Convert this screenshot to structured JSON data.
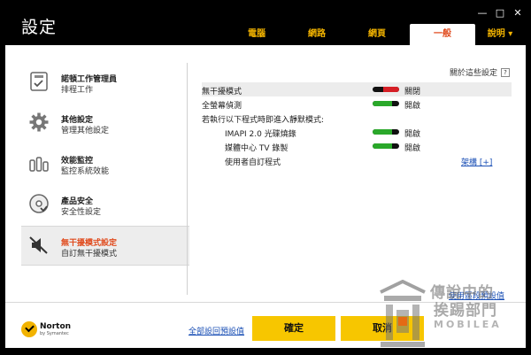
{
  "window": {
    "title": "設定",
    "controls": [
      "—",
      "□",
      "✕"
    ]
  },
  "tabs": [
    {
      "label": "電腦",
      "active": false
    },
    {
      "label": "網路",
      "active": false
    },
    {
      "label": "網頁",
      "active": false
    },
    {
      "label": "一般",
      "active": true
    },
    {
      "label": "說明 ▾",
      "active": false
    }
  ],
  "sidebar": {
    "items": [
      {
        "title": "諾頓工作管理員",
        "subtitle": "排程工作",
        "icon": "task-manager-icon"
      },
      {
        "title": "其他設定",
        "subtitle": "管理其他設定",
        "icon": "gear-icon"
      },
      {
        "title": "效能監控",
        "subtitle": "監控系統效能",
        "icon": "performance-bars-icon"
      },
      {
        "title": "產品安全",
        "subtitle": "安全性設定",
        "icon": "disc-security-icon"
      },
      {
        "title": "無干擾模式設定",
        "subtitle": "自訂無干擾模式",
        "icon": "muted-speaker-icon",
        "active": true
      }
    ]
  },
  "about": {
    "label": "關於這些設定",
    "help": "?"
  },
  "settings": {
    "quiet_mode": {
      "label": "無干擾模式",
      "state": "關閉",
      "on": false
    },
    "fullscreen": {
      "label": "全螢幕偵測",
      "state": "開啟",
      "on": true
    },
    "intro": "若執行以下程式時即進入靜默模式:",
    "imapi": {
      "label": "IMAPI 2.0 光碟燒錄",
      "state": "開啟",
      "on": true
    },
    "media_center": {
      "label": "媒體中心 TV 錄製",
      "state": "開啟",
      "on": true
    },
    "user_programs": {
      "label": "使用者自訂程式",
      "link": "架構 [+]"
    }
  },
  "footer": {
    "use_defaults": "使用區段預設值",
    "restore_all": "全部設回預設值",
    "ok": "確定",
    "cancel": "取消",
    "brand_name": "Norton",
    "brand_by": "by Symantec"
  },
  "watermark": {
    "line1": "傳說中的",
    "line2": "挨踢部門",
    "line3": "MOBILEA"
  },
  "colors": {
    "accent": "#f2b300",
    "active_tab_text": "#e0491b",
    "button": "#f7c600",
    "on": "#2aa82a",
    "off": "#d61f26",
    "link": "#1a4fb5"
  }
}
